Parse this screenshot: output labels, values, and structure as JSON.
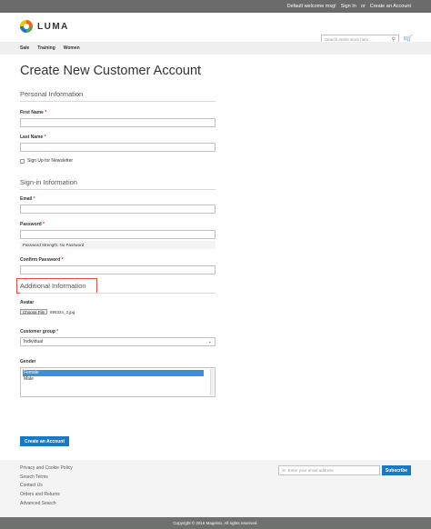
{
  "topbar": {
    "welcome": "Default welcome msg!",
    "sign_in": "Sign In",
    "or": "or",
    "create_account": "Create an Account"
  },
  "header": {
    "logo_text": "LUMA",
    "search_placeholder": "Search entire store here...",
    "search_icon": "search-icon",
    "cart_icon": "cart-icon"
  },
  "nav": {
    "items": [
      "Sale",
      "Training",
      "Women"
    ]
  },
  "page": {
    "title": "Create New Customer Account"
  },
  "personal": {
    "title": "Personal Information",
    "first_name_label": "First Name",
    "last_name_label": "Last Name",
    "required_mark": "*",
    "newsletter_label": "Sign Up for Newsletter"
  },
  "signin": {
    "title": "Sign-in Information",
    "email_label": "Email",
    "password_label": "Password",
    "strength_text": "Password Strength: No Password",
    "confirm_label": "Confirm Password"
  },
  "additional": {
    "title": "Additional Information",
    "avatar_label": "Avatar",
    "choose_file": "Choose File",
    "file_name": "695324_2.jpg",
    "group_label": "Customer group",
    "group_value": "Individual",
    "gender_label": "Gender",
    "gender_options": [
      "Female",
      "Male"
    ],
    "selected_gender": "Female"
  },
  "actions": {
    "submit_label": "Create an Account"
  },
  "footer": {
    "links": [
      "Privacy and Cookie Policy",
      "Search Terms",
      "Contact Us",
      "Orders and Returns",
      "Advanced Search"
    ],
    "newsletter_placeholder": "Enter your email address",
    "subscribe_label": "Subscribe",
    "copyright": "Copyright © 2016 Magento. All rights reserved."
  },
  "colors": {
    "accent": "#1979c3",
    "highlight_border": "#e74c3c",
    "required": "#e02b27"
  }
}
